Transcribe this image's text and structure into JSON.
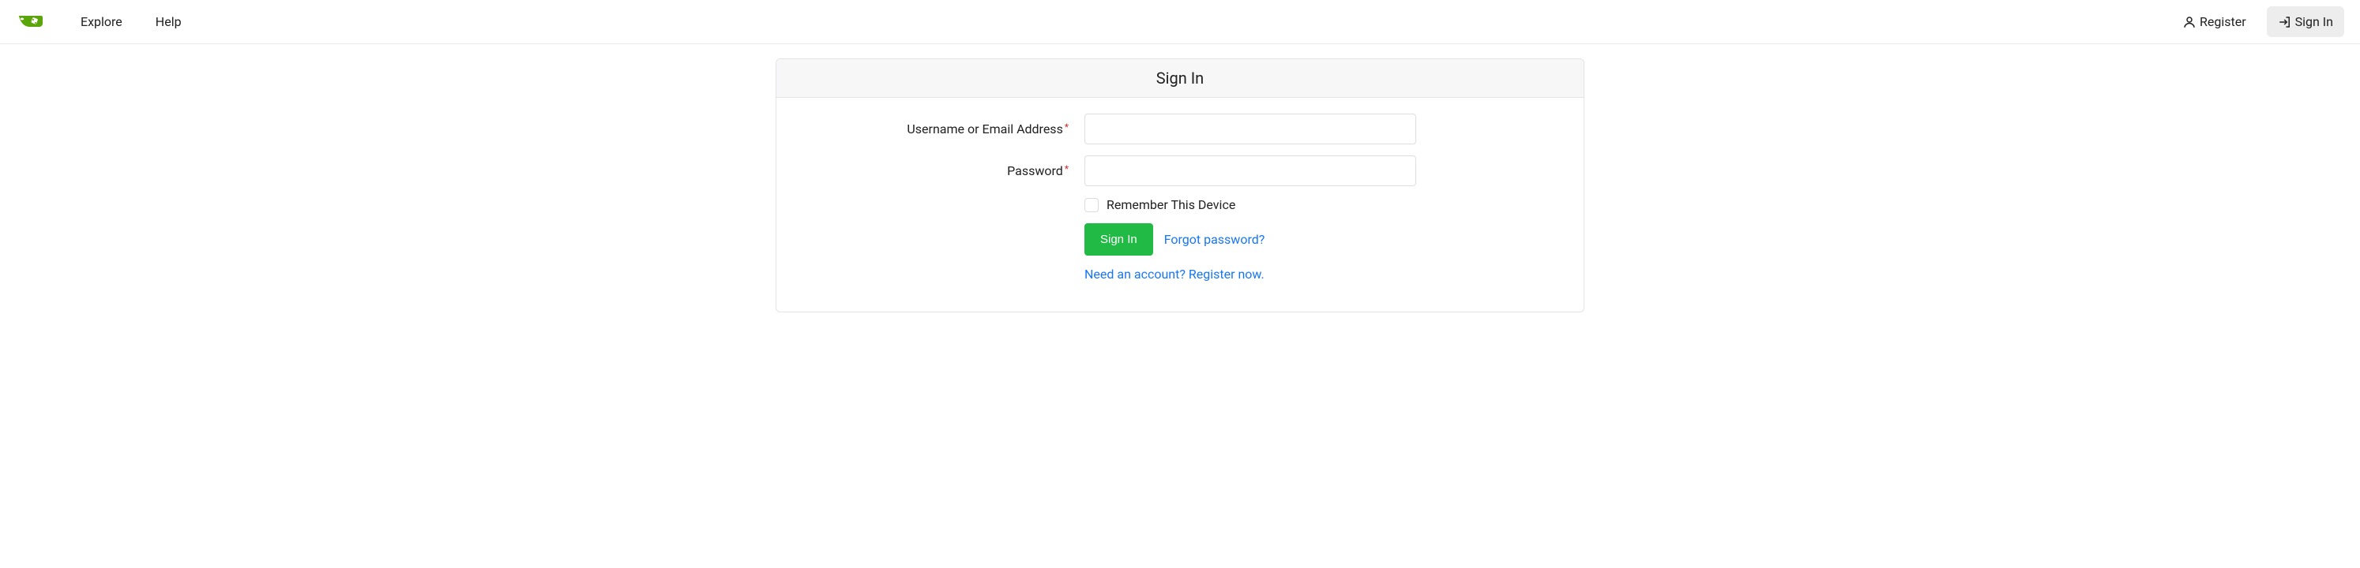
{
  "nav": {
    "explore": "Explore",
    "help": "Help",
    "register": "Register",
    "signin": "Sign In"
  },
  "form": {
    "title": "Sign In",
    "username_label": "Username or Email Address",
    "password_label": "Password",
    "remember_label": "Remember This Device",
    "submit": "Sign In",
    "forgot": "Forgot password?",
    "need_account": "Need an account? Register now."
  }
}
